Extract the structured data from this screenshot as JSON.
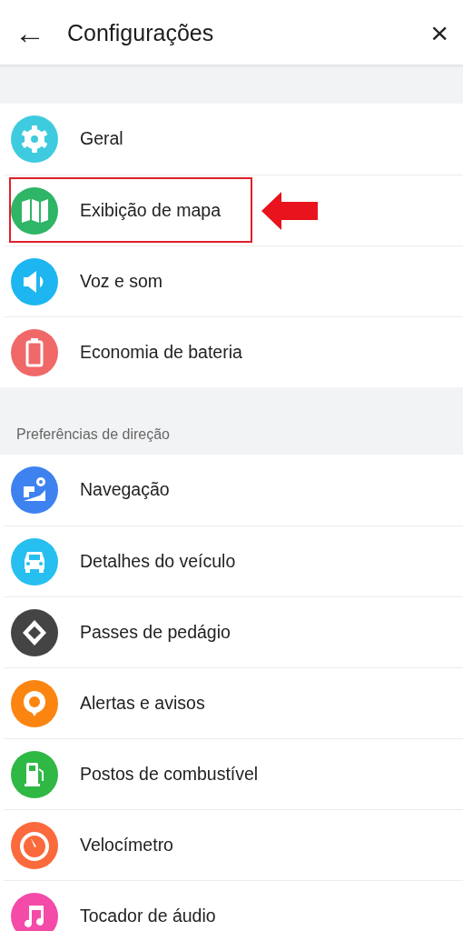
{
  "header": {
    "title": "Configurações",
    "back": "←",
    "close": "×"
  },
  "sections": [
    {
      "items": [
        {
          "label": "Geral",
          "kind": "gear",
          "color": "#3fcbdf",
          "highlighted": false
        },
        {
          "label": "Exibição de mapa",
          "kind": "map",
          "color": "#2eb566",
          "highlighted": true
        },
        {
          "label": "Voz e som",
          "kind": "speaker",
          "color": "#1eb6f0",
          "highlighted": false
        },
        {
          "label": "Economia de bateria",
          "kind": "battery",
          "color": "#f06868",
          "highlighted": false
        }
      ]
    },
    {
      "title": "Preferências de direção",
      "items": [
        {
          "label": "Navegação",
          "kind": "route",
          "color": "#3e82f0",
          "highlighted": false
        },
        {
          "label": "Detalhes do veículo",
          "kind": "car",
          "color": "#26bff0",
          "highlighted": false
        },
        {
          "label": "Passes de pedágio",
          "kind": "diamond",
          "color": "#444444",
          "highlighted": false
        },
        {
          "label": "Alertas e avisos",
          "kind": "pin",
          "color": "#fb8510",
          "highlighted": false
        },
        {
          "label": "Postos de combustível",
          "kind": "fuel",
          "color": "#2fb844",
          "highlighted": false
        },
        {
          "label": "Velocímetro",
          "kind": "gauge",
          "color": "#fa6a3c",
          "highlighted": false
        },
        {
          "label": "Tocador de áudio",
          "kind": "music",
          "color": "#f44aa8",
          "highlighted": false
        }
      ]
    }
  ]
}
